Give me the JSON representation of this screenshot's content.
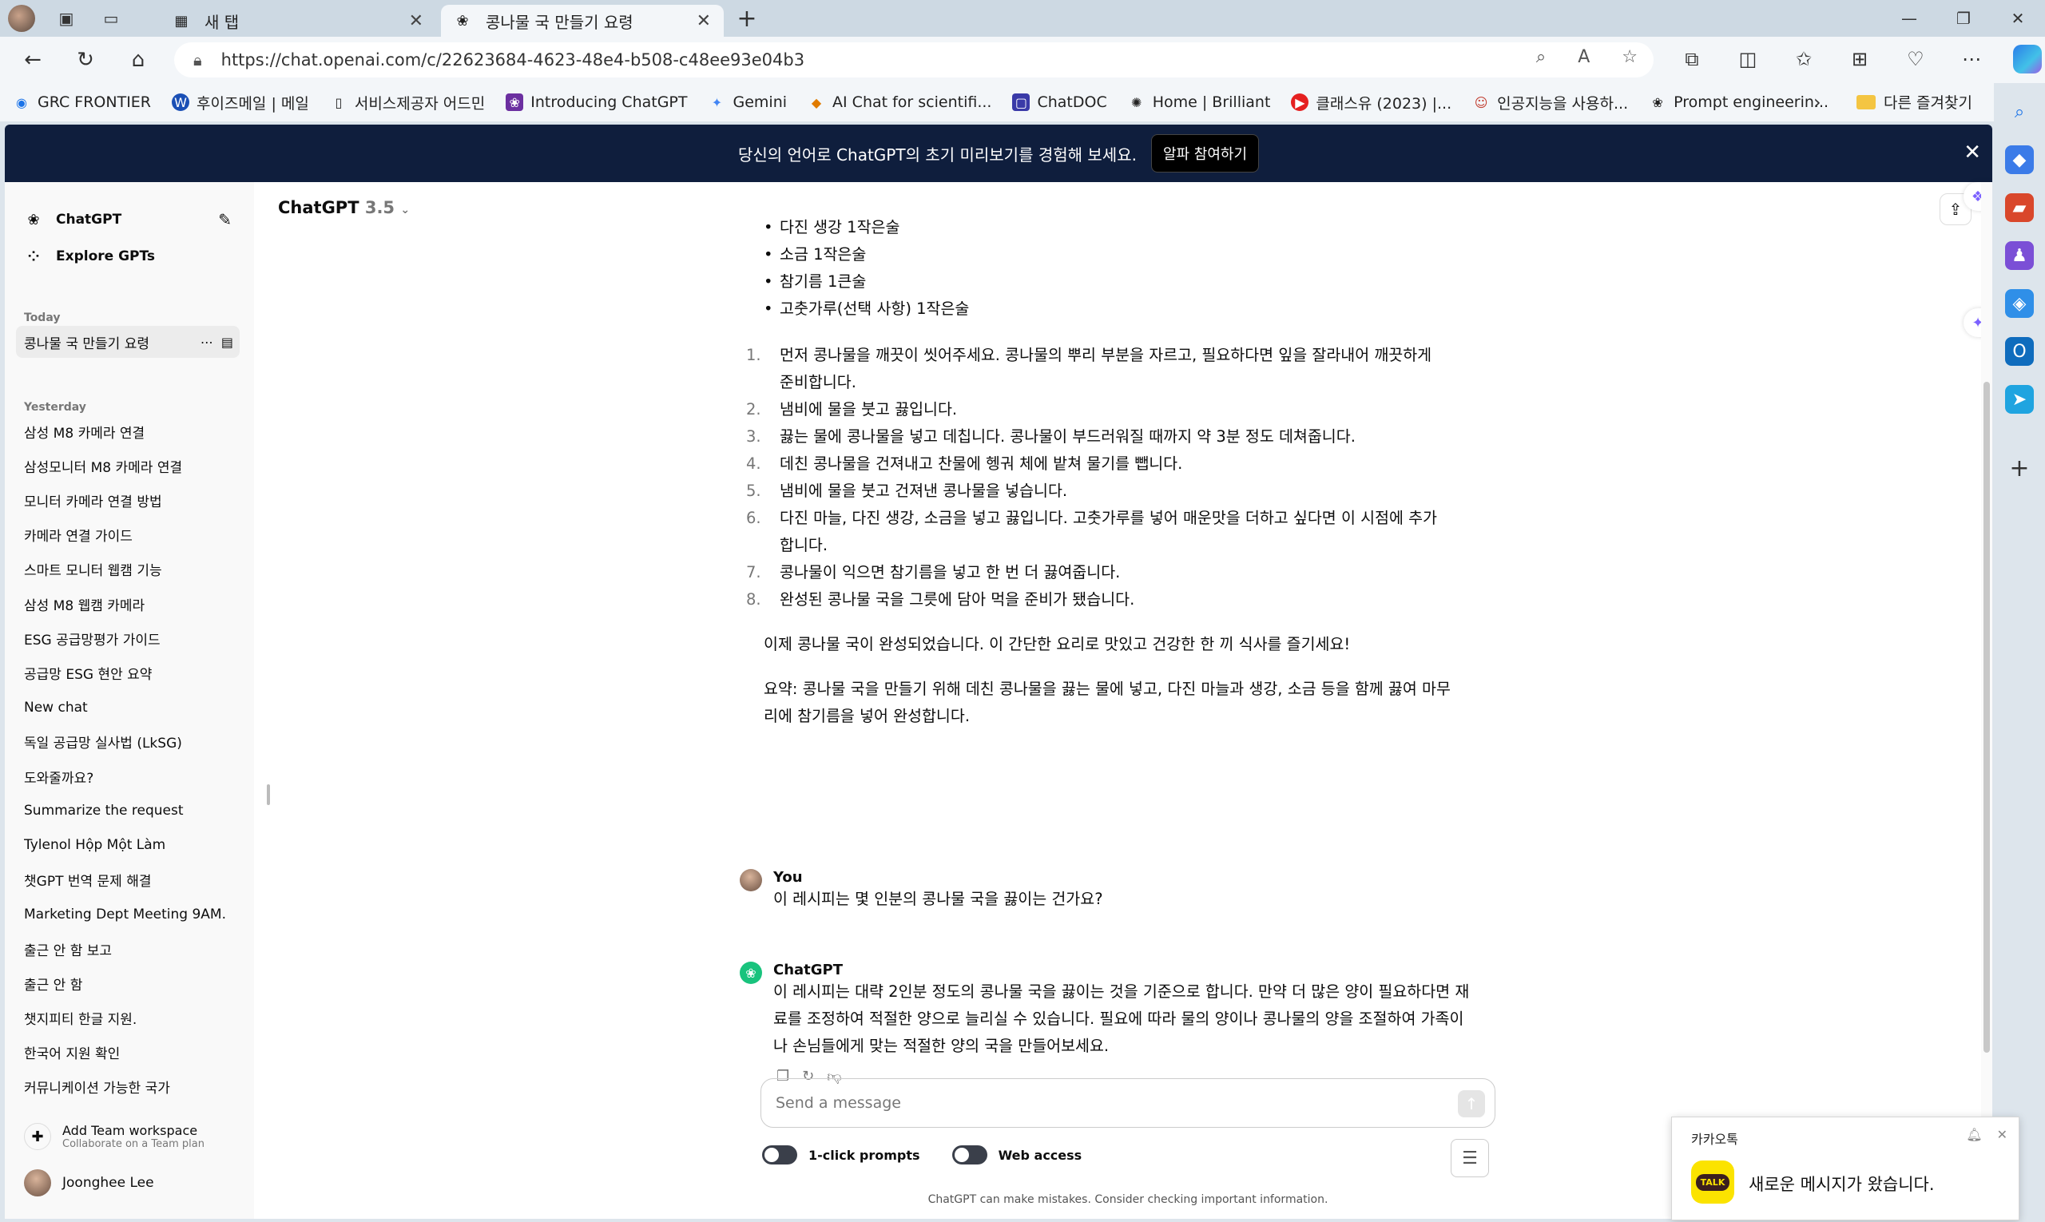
{
  "browser": {
    "tabs": [
      {
        "title": "새 탭",
        "active": false
      },
      {
        "title": "콩나물 국 만들기 요령",
        "active": true
      }
    ],
    "url": "https://chat.openai.com/c/22623684-4623-48e4-b508-c48ee93e04b3",
    "bookmarks": [
      {
        "label": "GRC FRONTIER",
        "color": "#1a73e8"
      },
      {
        "label": "후이즈메일 | 메일",
        "color": "#1a4fb5"
      },
      {
        "label": "서비스제공자 어드민",
        "color": "#555555"
      },
      {
        "label": "Introducing ChatGPT",
        "color": "#6b2fa0"
      },
      {
        "label": "Gemini",
        "color": "#4285f4"
      },
      {
        "label": "AI Chat for scientifi...",
        "color": "#e07b00"
      },
      {
        "label": "ChatDOC",
        "color": "#3a3aa8"
      },
      {
        "label": "Home | Brilliant",
        "color": "#333333"
      },
      {
        "label": "클래스유 (2023) |...",
        "color": "#e52020"
      },
      {
        "label": "인공지능을 사용하...",
        "color": "#c0392b"
      },
      {
        "label": "Prompt engineerin...",
        "color": "#333333"
      }
    ],
    "other_bookmarks": "다른 즐겨찾기"
  },
  "banner": {
    "text": "당신의 언어로 ChatGPT의 초기 미리보기를 경험해 보세요.",
    "button": "알파 참여하기"
  },
  "sidebar": {
    "app_name": "ChatGPT",
    "explore": "Explore GPTs",
    "today_label": "Today",
    "today_items": [
      "콩나물 국 만들기 요령"
    ],
    "yesterday_label": "Yesterday",
    "yesterday_items": [
      "삼성 M8 카메라 연결",
      "삼성모니터 M8 카메라 연결",
      "모니터 카메라 연결 방법",
      "카메라 연결 가이드",
      "스마트 모니터 웹캠 기능",
      "삼성 M8 웹캠 카메라",
      "ESG 공급망평가 가이드",
      "공급망 ESG 현안 요약",
      "New chat",
      "독일 공급망 실사법 (LkSG)",
      "도와줄까요?",
      "Summarize the request",
      "Tylenol Hộp Một Làm",
      "챗GPT 번역 문제 해결",
      "Marketing Dept Meeting 9AM.",
      "출근 안 함 보고",
      "출근 안 함",
      "챗지피티 한글 지원.",
      "한국어 지원 확인",
      "커뮤니케이션 가능한 국가"
    ],
    "team_title": "Add Team workspace",
    "team_sub": "Collaborate on a Team plan",
    "user_name": "Joonghee Lee"
  },
  "main": {
    "model_name": "ChatGPT",
    "model_version": "3.5",
    "ingredients": [
      "다진 생강 1작은술",
      "소금 1작은술",
      "참기름 1큰술",
      "고춧가루(선택 사항) 1작은술"
    ],
    "steps": [
      "먼저 콩나물을 깨끗이 씻어주세요. 콩나물의 뿌리 부분을 자르고, 필요하다면 잎을 잘라내어 깨끗하게 준비합니다.",
      "냄비에 물을 붓고 끓입니다.",
      "끓는 물에 콩나물을 넣고 데칩니다. 콩나물이 부드러워질 때까지 약 3분 정도 데쳐줍니다.",
      "데친 콩나물을 건져내고 찬물에 헹궈 체에 밭쳐 물기를 뺍니다.",
      "냄비에 물을 붓고 건져낸 콩나물을 넣습니다.",
      "다진 마늘, 다진 생강, 소금을 넣고 끓입니다. 고춧가루를 넣어 매운맛을 더하고 싶다면 이 시점에 추가합니다.",
      "콩나물이 익으면 참기름을 넣고 한 번 더 끓여줍니다.",
      "완성된 콩나물 국을 그릇에 담아 먹을 준비가 됐습니다."
    ],
    "closing": "이제 콩나물 국이 완성되었습니다. 이 간단한 요리로 맛있고 건강한 한 끼 식사를 즐기세요!",
    "summary": "요약: 콩나물 국을 만들기 위해 데친 콩나물을 끓는 물에 넣고, 다진 마늘과 생강, 소금 등을 함께 끓여 마무리에 참기름을 넣어 완성합니다.",
    "user_label": "You",
    "user_message": "이 레시피는 몇 인분의 콩나물 국을 끓이는 건가요?",
    "assistant_label": "ChatGPT",
    "assistant_message": "이 레시피는 대략 2인분 정도의 콩나물 국을 끓이는 것을 기준으로 합니다. 만약 더 많은 양이 필요하다면 재료를 조정하여 적절한 양으로 늘리실 수 있습니다. 필요에 따라 물의 양이나 콩나물의 양을 조절하여 가족이나 손님들에게 맞는 적절한 양의 국을 만들어보세요.",
    "composer_placeholder": "Send a message",
    "toggle_one_click": "1-click prompts",
    "toggle_web": "Web access",
    "disclaimer": "ChatGPT can make mistakes. Consider checking important information."
  },
  "toast": {
    "app": "카카오톡",
    "message": "새로운 메시지가 왔습니다.",
    "logo_text": "TALK"
  }
}
